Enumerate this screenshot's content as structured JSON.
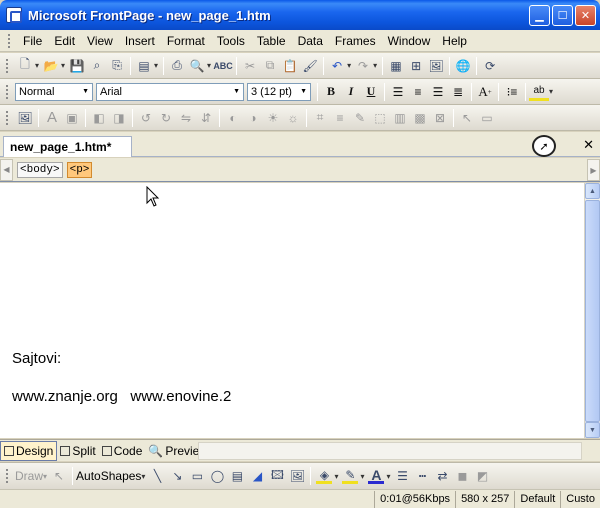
{
  "window": {
    "title": "Microsoft FrontPage - new_page_1.htm",
    "controls": [
      "minimize",
      "maximize",
      "close"
    ]
  },
  "menu": {
    "items": [
      {
        "label": "File"
      },
      {
        "label": "Edit"
      },
      {
        "label": "View"
      },
      {
        "label": "Insert"
      },
      {
        "label": "Format"
      },
      {
        "label": "Tools"
      },
      {
        "label": "Table"
      },
      {
        "label": "Data"
      },
      {
        "label": "Frames"
      },
      {
        "label": "Window"
      },
      {
        "label": "Help"
      }
    ]
  },
  "formatting": {
    "style_value": "Normal",
    "font_value": "Arial",
    "size_value": "3  (12 pt)",
    "bold": "B",
    "italic": "I",
    "underline": "U"
  },
  "document": {
    "tab_label": "new_page_1.htm*",
    "close_label": "✕"
  },
  "tags": {
    "items": [
      "<body>",
      "<p>"
    ],
    "active_index": 1
  },
  "editor": {
    "lines": [
      "Sajtovi:",
      "www.znanje.org   www.enovine.2"
    ]
  },
  "view_tabs": [
    {
      "label": "Design",
      "active": true
    },
    {
      "label": "Split",
      "active": false
    },
    {
      "label": "Code",
      "active": false
    },
    {
      "label": "Preview",
      "active": false
    }
  ],
  "drawing": {
    "draw_label": "Draw",
    "autoshapes_label": "AutoShapes"
  },
  "status": {
    "speed": "0:01@56Kbps",
    "dimensions": "580 x 257",
    "mode": "Default",
    "custom": "Custo"
  },
  "colors": {
    "titlebar": "#0a58e8",
    "chrome": "#ece9d8",
    "active_tag": "#ffc87c"
  }
}
